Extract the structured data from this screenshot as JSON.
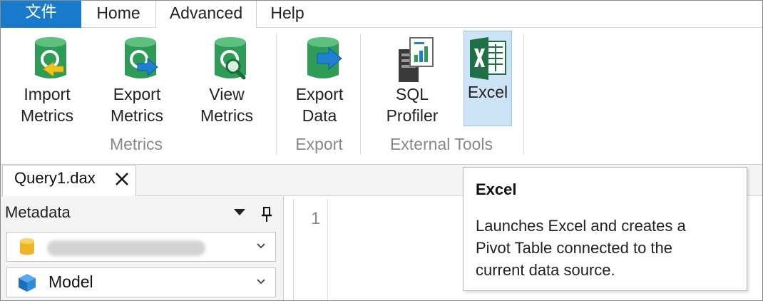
{
  "ribbon": {
    "tabs": {
      "file": "文件",
      "home": "Home",
      "advanced": "Advanced",
      "help": "Help"
    },
    "buttons": {
      "import_metrics": [
        "Import",
        "Metrics"
      ],
      "export_metrics": [
        "Export",
        "Metrics"
      ],
      "view_metrics": [
        "View",
        "Metrics"
      ],
      "export_data": [
        "Export",
        "Data"
      ],
      "sql_profiler": [
        "SQL",
        "Profiler"
      ],
      "excel": "Excel"
    },
    "groups": {
      "metrics": "Metrics",
      "export": "Export",
      "external_tools": "External Tools"
    },
    "selected_button": "excel"
  },
  "document": {
    "tab_name": "Query1.dax"
  },
  "metadata_pane": {
    "title": "Metadata",
    "database_value": "",
    "model_value": "Model"
  },
  "editor": {
    "line_numbers": [
      "1"
    ]
  },
  "tooltip": {
    "title": "Excel",
    "body": [
      "Launches Excel and creates a",
      "Pivot Table connected to the",
      "current data source."
    ]
  },
  "colors": {
    "file_tab": "#1979ca",
    "selected_button_bg": "#cde4f7",
    "db_green": "#2e9b57",
    "arrow_blue": "#1f7fd0",
    "arrow_yellow": "#f3c21f",
    "excel_green": "#1e7145"
  },
  "icons": {
    "import_metrics": "database-import-icon",
    "export_metrics": "database-export-icon",
    "view_metrics": "database-view-icon",
    "export_data": "database-arrow-icon",
    "sql_profiler": "server-chart-icon",
    "excel": "excel-icon",
    "close": "close-icon",
    "dropdown": "dropdown-triangle-icon",
    "pin": "pin-icon",
    "database": "database-icon",
    "model": "cube-icon",
    "chevron": "chevron-down-icon"
  }
}
